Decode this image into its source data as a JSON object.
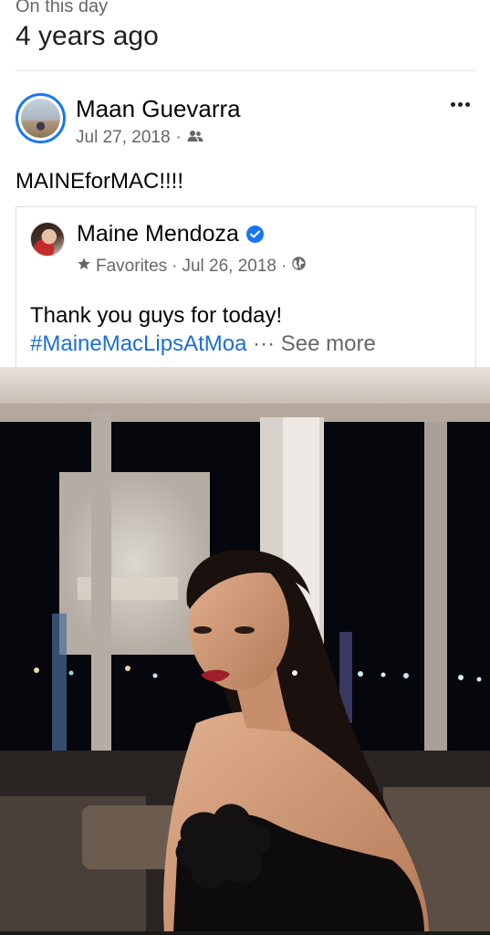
{
  "memory": {
    "label": "On this day",
    "title": "4 years ago"
  },
  "post": {
    "author": "Maan Guevarra",
    "date": "Jul 27, 2018",
    "separator": "·",
    "audience_icon": "friends-icon",
    "text": "MAINEforMAC!!!!"
  },
  "shared": {
    "author": "Maine Mendoza",
    "verified": true,
    "list_icon": "star-icon",
    "list_label": "Favorites",
    "separator": "·",
    "date": "Jul 26, 2018",
    "audience_icon": "globe-icon",
    "text": "Thank you guys for today!",
    "hashtag": "#MaineMacLipsAtMoa",
    "ellipsis": "···",
    "see_more": "See more"
  },
  "colors": {
    "accent": "#1877f2",
    "link": "#1b6fd6",
    "secondary_text": "#65676b"
  }
}
